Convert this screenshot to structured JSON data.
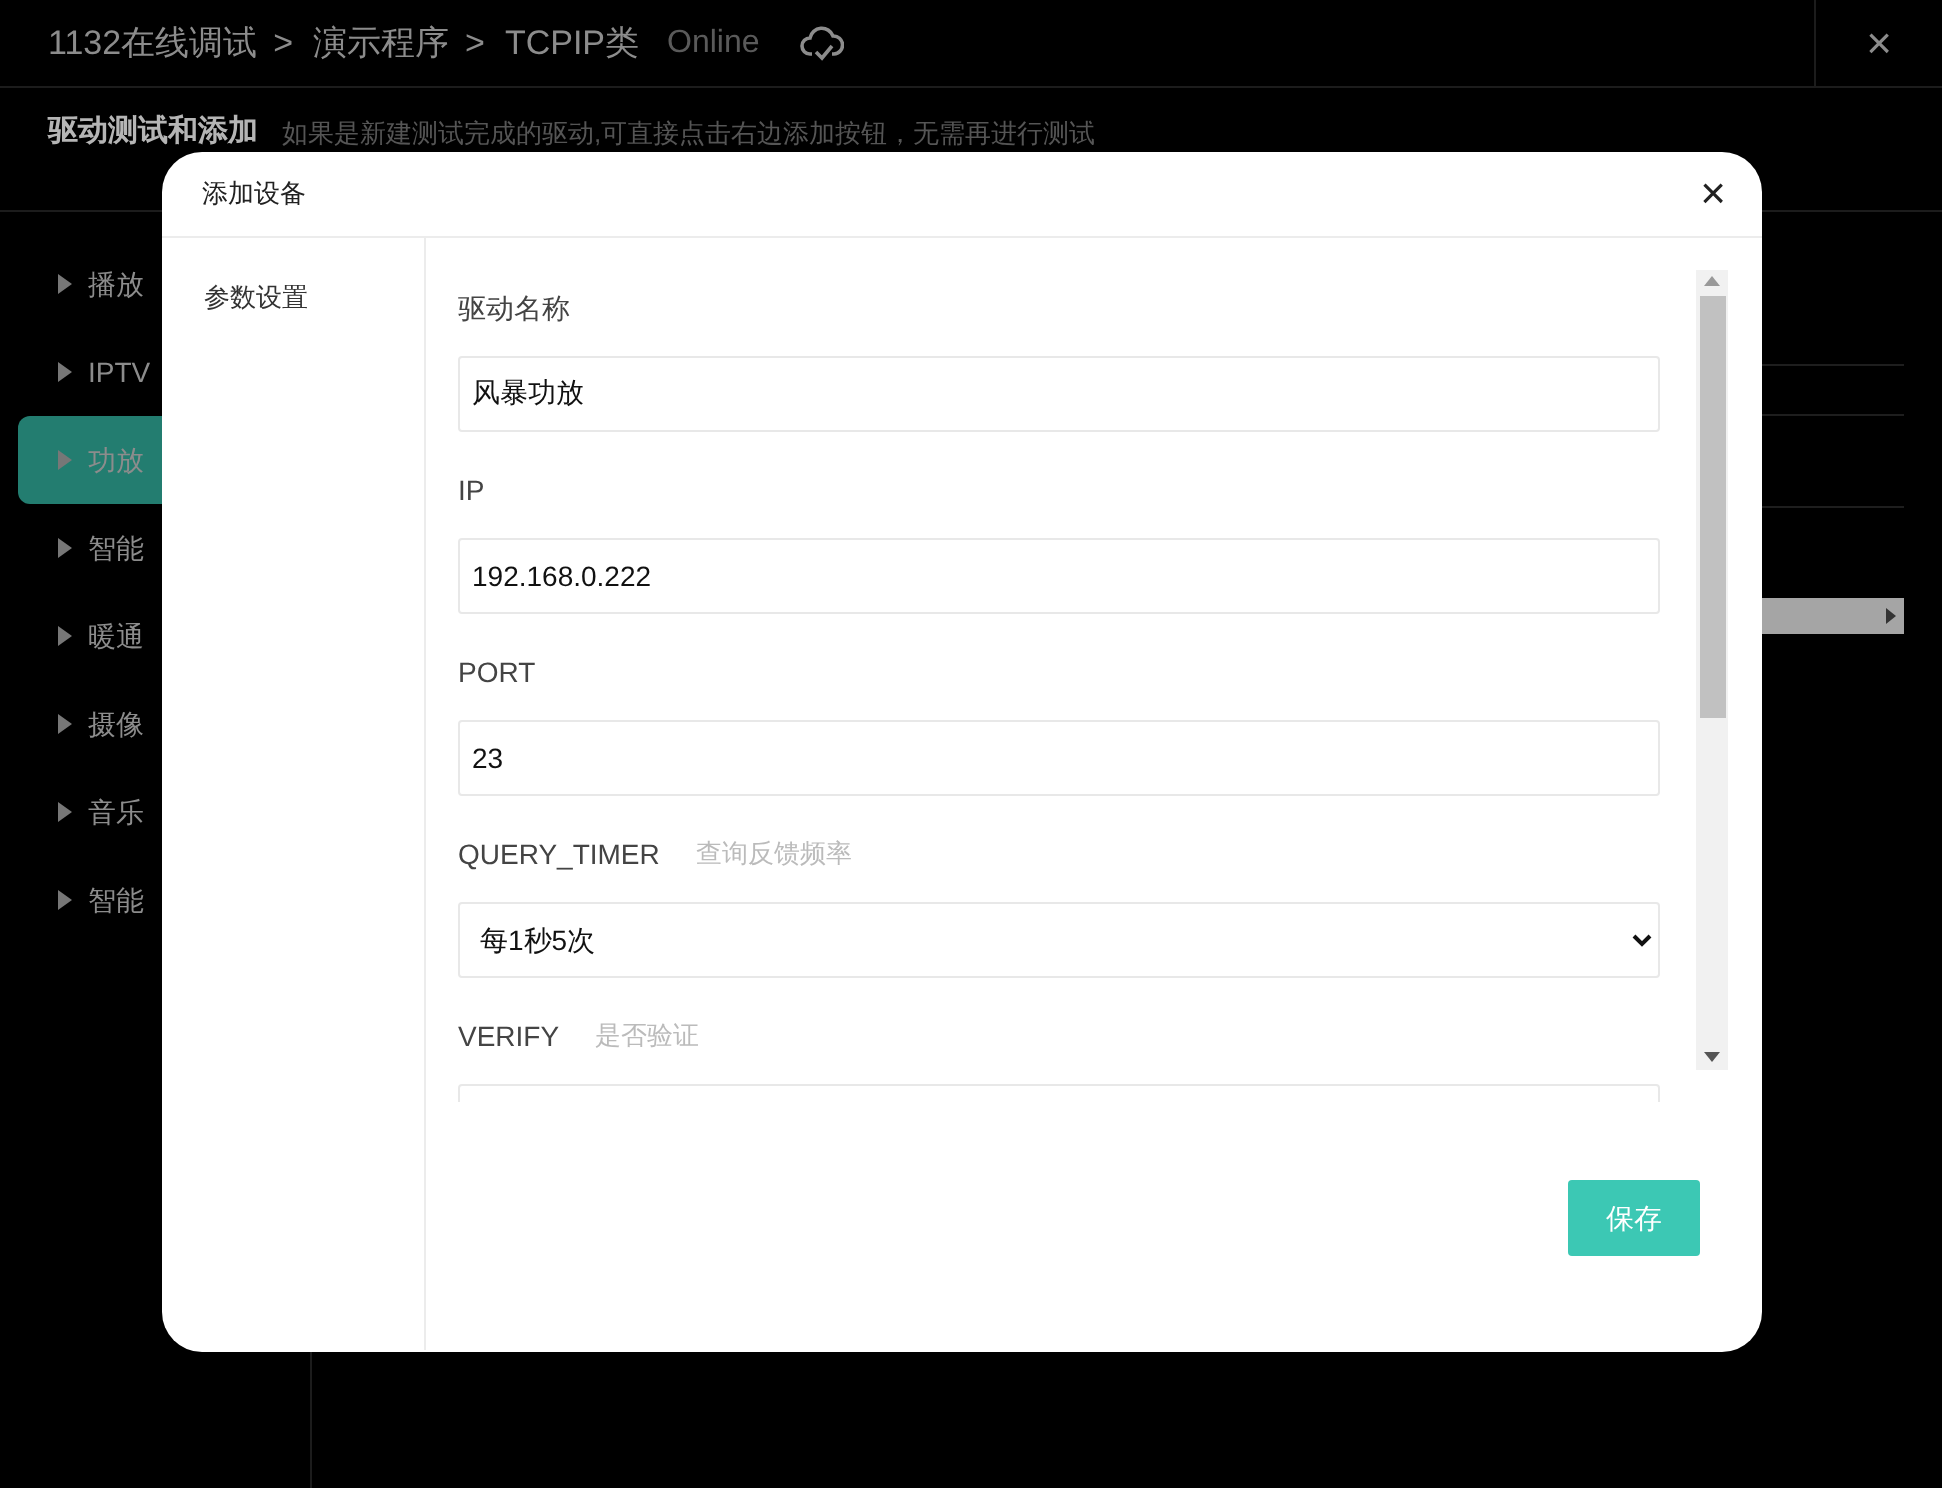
{
  "breadcrumb": [
    {
      "label": "1132在线调试",
      "separator": ">"
    },
    {
      "label": "演示程序",
      "separator": ">"
    },
    {
      "label": "TCPIP类"
    }
  ],
  "status": "Online",
  "close": "×",
  "section": {
    "title": "驱动测试和添加",
    "hint": "如果是新建测试完成的驱动,可直接点击右边添加按钮，无需再进行测试"
  },
  "sidebar": {
    "items": [
      {
        "label": "播放",
        "selected": false
      },
      {
        "label": "IPTV",
        "selected": false
      },
      {
        "label": "功放",
        "selected": true
      },
      {
        "label": "智能",
        "selected": false
      },
      {
        "label": "暖通",
        "selected": false
      },
      {
        "label": "摄像",
        "selected": false
      },
      {
        "label": "音乐",
        "selected": false
      },
      {
        "label": "智能",
        "selected": false
      }
    ]
  },
  "dialog": {
    "title": "添加设备",
    "close": "×",
    "nav": [
      {
        "label": "参数设置",
        "selected": true
      }
    ],
    "fields": [
      {
        "kind": "text",
        "label": "驱动名称",
        "value": "风暴功放"
      },
      {
        "kind": "text",
        "label": "IP",
        "value": "192.168.0.222"
      },
      {
        "kind": "text",
        "label": "PORT",
        "value": "23"
      },
      {
        "kind": "select",
        "label": "QUERY_TIMER",
        "hint": "查询反馈频率",
        "value": "每1秒5次"
      },
      {
        "kind": "text",
        "label": "VERIFY",
        "hint": "是否验证"
      }
    ],
    "save": "保存"
  }
}
